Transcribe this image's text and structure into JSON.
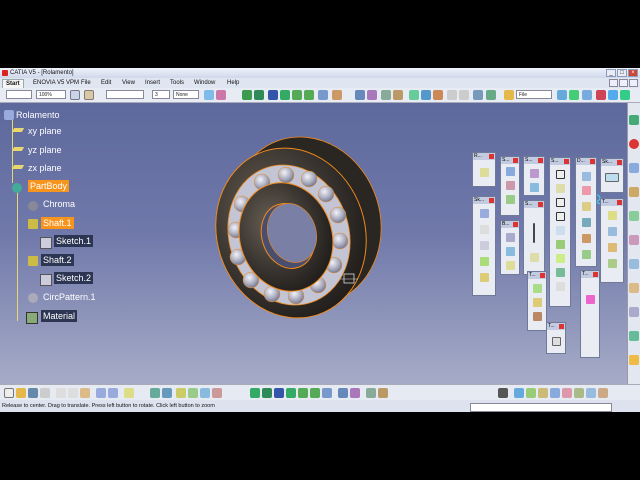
{
  "window": {
    "title": "CATIA V5 - [Rolamento]"
  },
  "menu": {
    "start": "Start",
    "items": [
      "ENOVIA V5 VPM",
      "File",
      "Edit",
      "View",
      "Insert",
      "Tools",
      "Window",
      "Help"
    ]
  },
  "toolbar": {
    "zoom_value": "100%",
    "line_value": "3",
    "none_value": "None",
    "file_field": "File"
  },
  "tree": {
    "root": "Rolamento",
    "xy": "xy plane",
    "yz": "yz plane",
    "zx": "zx plane",
    "partbody": "PartBody",
    "chroma": "Chroma",
    "shaft1": "Shaft.1",
    "sketch1": "Sketch.1",
    "shaft2": "Shaft.2",
    "sketch2": "Sketch.2",
    "circpattern": "CircPattern.1",
    "material": "Material"
  },
  "panels": {
    "p1": "R...",
    "p2": "S...",
    "p3": "S...",
    "p4": "S...",
    "p5": "D...",
    "p6": "Sk...",
    "p7": "Sk...",
    "p8": "B...",
    "p9": "T...",
    "p10": "T...",
    "p11": "T..."
  },
  "status": {
    "text": "Release to center. Drag to translate. Press left button to rotate. Click left button to zoom"
  },
  "colors": {
    "selection": "#f7941e",
    "highlight_edge": "#f08a1c",
    "part": "#3a3530"
  }
}
